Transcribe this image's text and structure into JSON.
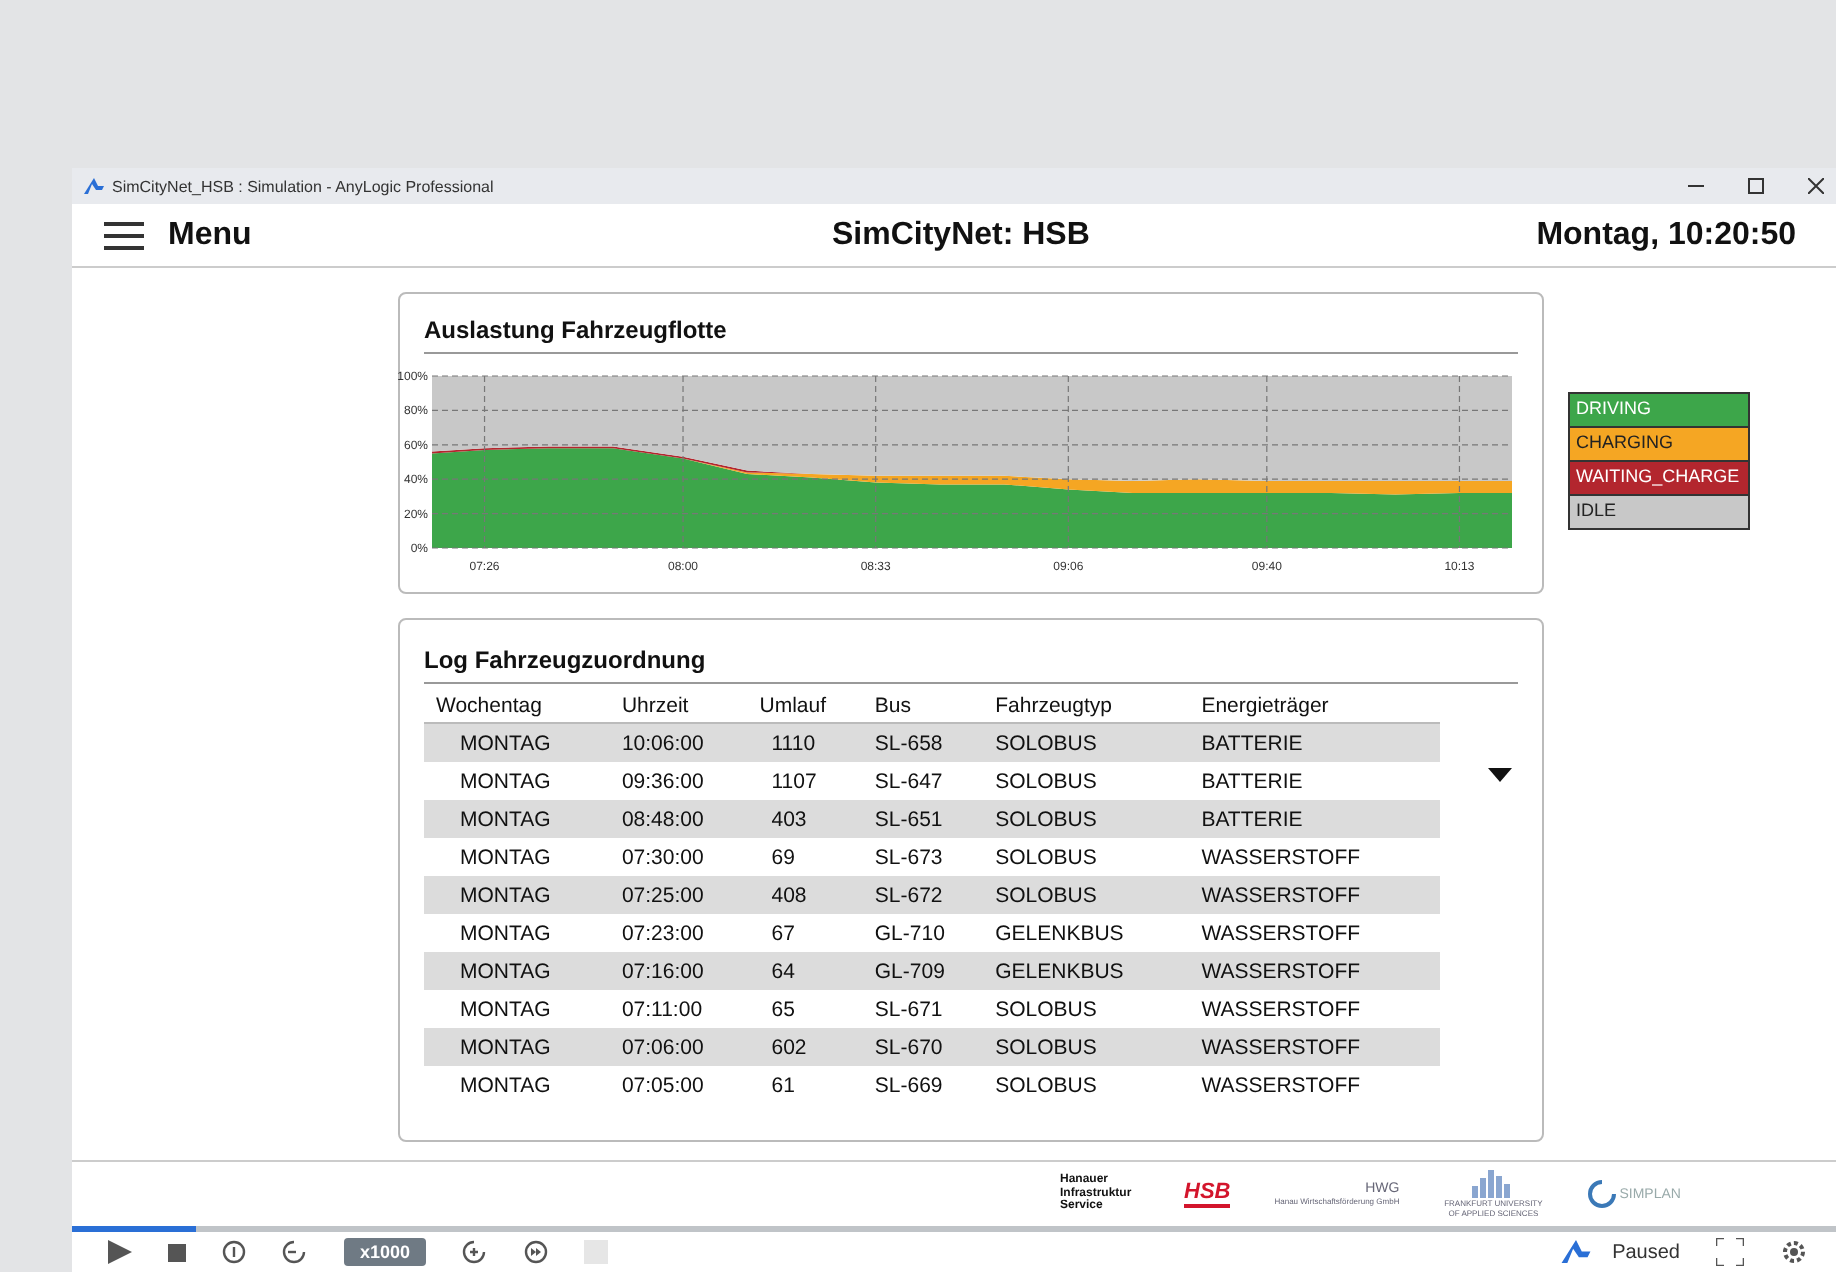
{
  "window": {
    "title": "SimCityNet_HSB : Simulation - AnyLogic Professional"
  },
  "header": {
    "menu_label": "Menu",
    "title": "SimCityNet: HSB",
    "clock": "Montag, 10:20:50"
  },
  "utilization": {
    "title": "Auslastung Fahrzeugflotte",
    "chart_data": {
      "type": "area",
      "stacked": true,
      "grid": true,
      "x": [
        437,
        446,
        457,
        468,
        480,
        491,
        502,
        513,
        524,
        535,
        546,
        557,
        568,
        580,
        591,
        602,
        613,
        622
      ],
      "xlim": [
        437,
        622
      ],
      "xticks": [
        {
          "value": 446,
          "label": "07:26"
        },
        {
          "value": 480,
          "label": "08:00"
        },
        {
          "value": 513,
          "label": "08:33"
        },
        {
          "value": 546,
          "label": "09:06"
        },
        {
          "value": 580,
          "label": "09:40"
        },
        {
          "value": 613,
          "label": "10:13"
        }
      ],
      "yticks": [
        {
          "value": 0,
          "label": "0%"
        },
        {
          "value": 20,
          "label": "20%"
        },
        {
          "value": 40,
          "label": "40%"
        },
        {
          "value": 60,
          "label": "60%"
        },
        {
          "value": 80,
          "label": "80%"
        },
        {
          "value": 100,
          "label": "100%"
        }
      ],
      "ylim": [
        0,
        100
      ],
      "series": [
        {
          "name": "DRIVING",
          "color": "#3da64a",
          "values": [
            55,
            57,
            58,
            58,
            52,
            43,
            41,
            38,
            37,
            37,
            34,
            32,
            32,
            32,
            32,
            31,
            32,
            32
          ]
        },
        {
          "name": "CHARGING",
          "color": "#f5a623",
          "values": [
            0,
            0,
            0,
            0,
            0,
            1,
            2,
            4,
            5,
            5,
            6,
            7,
            8,
            7,
            7,
            8,
            7,
            7
          ]
        },
        {
          "name": "WAITING_CHARGE",
          "color": "#b3262e",
          "values": [
            1,
            1,
            1,
            1,
            1,
            1,
            0,
            0,
            0,
            0,
            0,
            0,
            0,
            0,
            0,
            0,
            0,
            0
          ]
        },
        {
          "name": "IDLE",
          "color": "#c8c8c8",
          "values": [
            44,
            42,
            41,
            41,
            47,
            55,
            57,
            58,
            58,
            58,
            60,
            61,
            60,
            61,
            61,
            61,
            61,
            61
          ]
        }
      ]
    }
  },
  "log": {
    "title": "Log Fahrzeugzuordnung",
    "columns": [
      "Wochentag",
      "Uhrzeit",
      "Umlauf",
      "Bus",
      "Fahrzeugtyp",
      "Energieträger"
    ],
    "rows": [
      [
        "MONTAG",
        "10:06:00",
        "1110",
        "SL-658",
        "SOLOBUS",
        "BATTERIE"
      ],
      [
        "MONTAG",
        "09:36:00",
        "1107",
        "SL-647",
        "SOLOBUS",
        "BATTERIE"
      ],
      [
        "MONTAG",
        "08:48:00",
        "403",
        "SL-651",
        "SOLOBUS",
        "BATTERIE"
      ],
      [
        "MONTAG",
        "07:30:00",
        "69",
        "SL-673",
        "SOLOBUS",
        "WASSERSTOFF"
      ],
      [
        "MONTAG",
        "07:25:00",
        "408",
        "SL-672",
        "SOLOBUS",
        "WASSERSTOFF"
      ],
      [
        "MONTAG",
        "07:23:00",
        "67",
        "GL-710",
        "GELENKBUS",
        "WASSERSTOFF"
      ],
      [
        "MONTAG",
        "07:16:00",
        "64",
        "GL-709",
        "GELENKBUS",
        "WASSERSTOFF"
      ],
      [
        "MONTAG",
        "07:11:00",
        "65",
        "SL-671",
        "SOLOBUS",
        "WASSERSTOFF"
      ],
      [
        "MONTAG",
        "07:06:00",
        "602",
        "SL-670",
        "SOLOBUS",
        "WASSERSTOFF"
      ],
      [
        "MONTAG",
        "07:05:00",
        "61",
        "SL-669",
        "SOLOBUS",
        "WASSERSTOFF"
      ]
    ]
  },
  "logos": {
    "his": "Hanauer Infrastruktur Service",
    "hsb": "HSB",
    "hwg": "HWG",
    "hwg_sub": "Hanau Wirtschaftsförderung GmbH",
    "fra": "FRANKFURT UNIVERSITY OF APPLIED SCIENCES",
    "simplan": "SIMPLAN"
  },
  "controls": {
    "speed": "x1000",
    "status": "Paused",
    "progress": {
      "level": 0.07
    }
  }
}
